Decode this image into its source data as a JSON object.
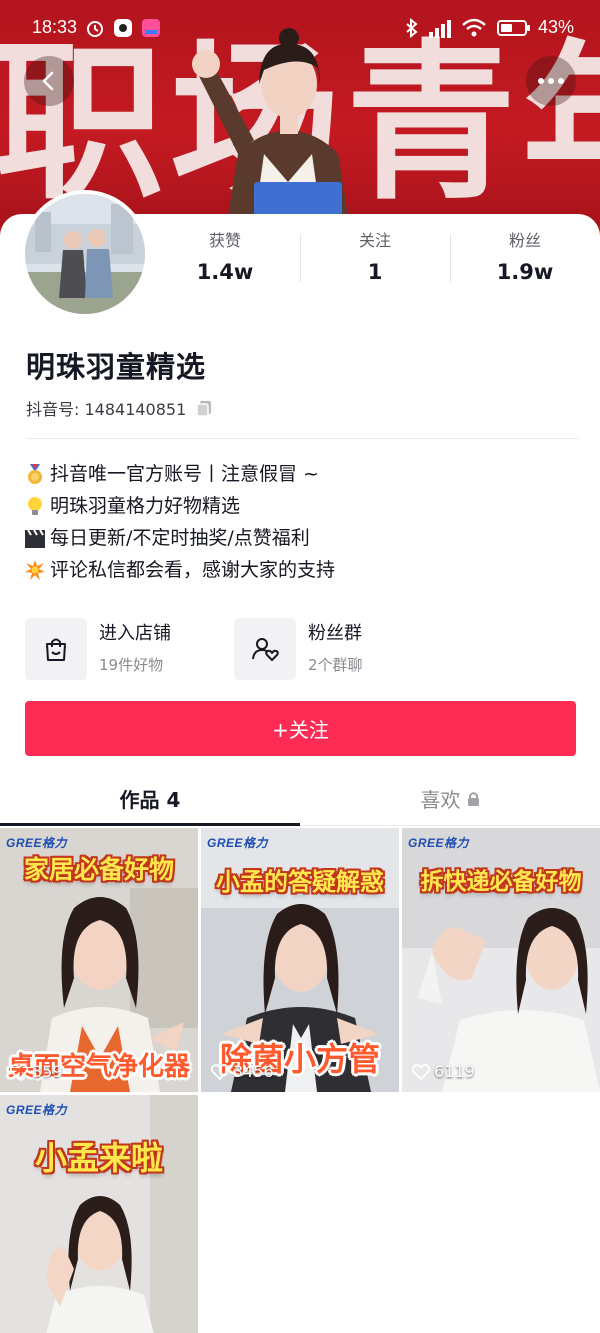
{
  "status_bar": {
    "time": "18:33",
    "battery": "43%",
    "icons": [
      "alarm-icon",
      "app-icon",
      "lala-app-icon",
      "bluetooth-icon",
      "hd-signal-icon",
      "wifi-icon",
      "battery-icon"
    ]
  },
  "banner": {
    "text": "职场青年"
  },
  "header": {
    "back_icon": "chevron-left-icon",
    "more_icon": "more-dots-icon"
  },
  "profile": {
    "stats": [
      {
        "label": "获赞",
        "value": "1.4w"
      },
      {
        "label": "关注",
        "value": "1"
      },
      {
        "label": "粉丝",
        "value": "1.9w"
      }
    ],
    "nickname": "明珠羽童精选",
    "douyin_id": "抖音号: 1484140851",
    "bio": [
      {
        "emoji": "medal-icon",
        "text": "抖音唯一官方账号丨注意假冒 ~"
      },
      {
        "emoji": "lightbulb-icon",
        "text": "明珠羽童格力好物精选"
      },
      {
        "emoji": "clapperboard-icon",
        "text": "每日更新/不定时抽奖/点赞福利"
      },
      {
        "emoji": "collision-icon",
        "text": "评论私信都会看，感谢大家的支持"
      }
    ]
  },
  "shortcuts": {
    "shop": {
      "title": "进入店铺",
      "subtitle": "19件好物",
      "icon": "shopping-bag-icon"
    },
    "fans": {
      "title": "粉丝群",
      "subtitle": "2个群聊",
      "icon": "fan-group-icon"
    }
  },
  "follow_button": {
    "label": "+关注",
    "color": "#fe2c55"
  },
  "tabs": {
    "works": "作品 4",
    "likes": "喜欢"
  },
  "videos": [
    {
      "brand": "GREE格力",
      "title": "家居必备好物",
      "bottom_text": "桌面空气净化器",
      "likes": "359"
    },
    {
      "brand": "GREE格力",
      "title": "小孟的答疑解惑",
      "bottom_text": "除菌小方管",
      "likes": "3456"
    },
    {
      "brand": "GREE格力",
      "title": "拆快递必备好物",
      "bottom_text": "",
      "likes": "6119"
    },
    {
      "brand": "GREE格力",
      "title": "小孟来啦",
      "bottom_text": "",
      "likes": ""
    }
  ]
}
